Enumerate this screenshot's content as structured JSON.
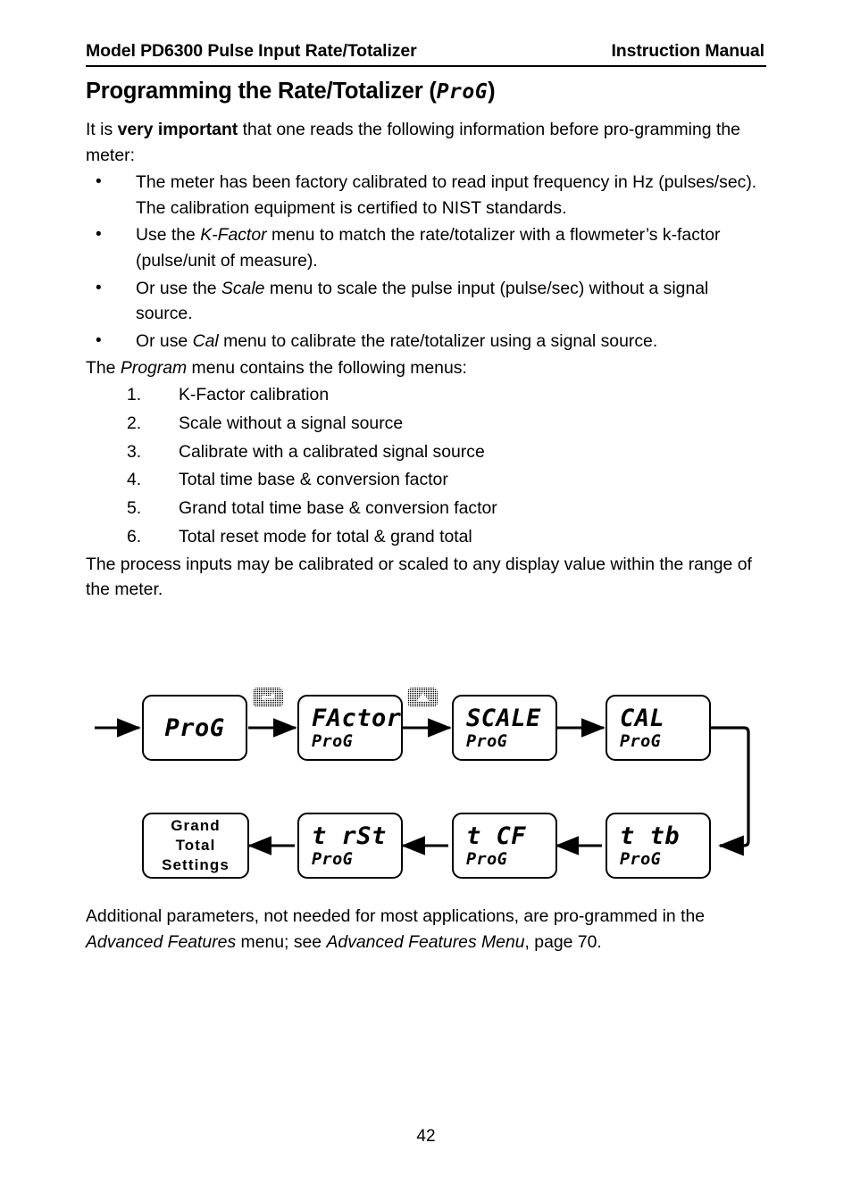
{
  "header": {
    "left": "Model PD6300 Pulse Input Rate/Totalizer",
    "right": "Instruction Manual"
  },
  "heading": {
    "text": "Programming the Rate/Totalizer (",
    "lcd": "ProG",
    "suffix": ")"
  },
  "intro": {
    "before": "It is ",
    "bold": "very important",
    "after": " that one reads the following information before pro-gramming the meter:"
  },
  "bullets": [
    {
      "marker": "•",
      "parts": [
        {
          "text": "The meter has been factory calibrated to read input frequency in Hz (pulses/sec). The calibration equipment is certified to NIST stan-dards.",
          "style": "normal"
        }
      ],
      "plain": "The meter has been factory calibrated to read input frequency in Hz (pulses/sec). The calibration equipment is certified to NIST standards."
    },
    {
      "marker": "•",
      "pre": "Use the ",
      "italic": "K-Factor",
      "post": " menu to match the rate/totalizer with a flowmeter’s k-factor (pulse/unit of measure)."
    },
    {
      "marker": "•",
      "pre": "Or use the ",
      "italic": "Scale",
      "post": " menu to scale the pulse input (pulse/sec) without a signal source."
    },
    {
      "marker": "•",
      "pre": "Or use ",
      "italic": "Cal",
      "post": " menu to calibrate the rate/totalizer using a signal source."
    }
  ],
  "menu_intro": {
    "pre": "The ",
    "italic": "Program",
    "post": " menu contains the following menus:"
  },
  "numbered_list": [
    {
      "num": "1.",
      "label": "K-Factor calibration"
    },
    {
      "num": "2.",
      "label": "Scale without a signal source"
    },
    {
      "num": "3.",
      "label": "Calibrate with a calibrated signal source"
    },
    {
      "num": "4.",
      "label": "Total time base & conversion factor"
    },
    {
      "num": "5.",
      "label": "Grand total time base & conversion factor"
    },
    {
      "num": "6.",
      "label": "Total reset mode for total & grand total"
    }
  ],
  "after_list": "The process inputs may be calibrated or scaled to any display value within the range of the meter.",
  "diagram": {
    "nodes": [
      {
        "id": "prog",
        "main": "ProG",
        "sub": ""
      },
      {
        "id": "factor",
        "main": "FActor",
        "sub": "ProG"
      },
      {
        "id": "scale",
        "main": "SCALE",
        "sub": "ProG"
      },
      {
        "id": "cal",
        "main": "CAL",
        "sub": "ProG"
      },
      {
        "id": "ttb",
        "main": "t tb",
        "sub": "ProG"
      },
      {
        "id": "tcf",
        "main": "t CF",
        "sub": "ProG"
      },
      {
        "id": "trst",
        "main": "t rSt",
        "sub": "ProG"
      },
      {
        "id": "grand",
        "line1": "Grand",
        "line2": "Total",
        "line3": "Settings"
      }
    ],
    "keys": [
      {
        "id": "enter-key",
        "icon": "enter-arrow-icon"
      },
      {
        "id": "up-key",
        "icon": "up-arrow-icon"
      }
    ]
  },
  "closing": {
    "pre": "Additional parameters, not needed for most applications, are pro-grammed in the ",
    "italic1": "Advanced Features",
    "mid": " menu; see ",
    "italic2": "Advanced Features Menu",
    "post": ", page 70."
  },
  "footer": {
    "page_number": "42"
  }
}
